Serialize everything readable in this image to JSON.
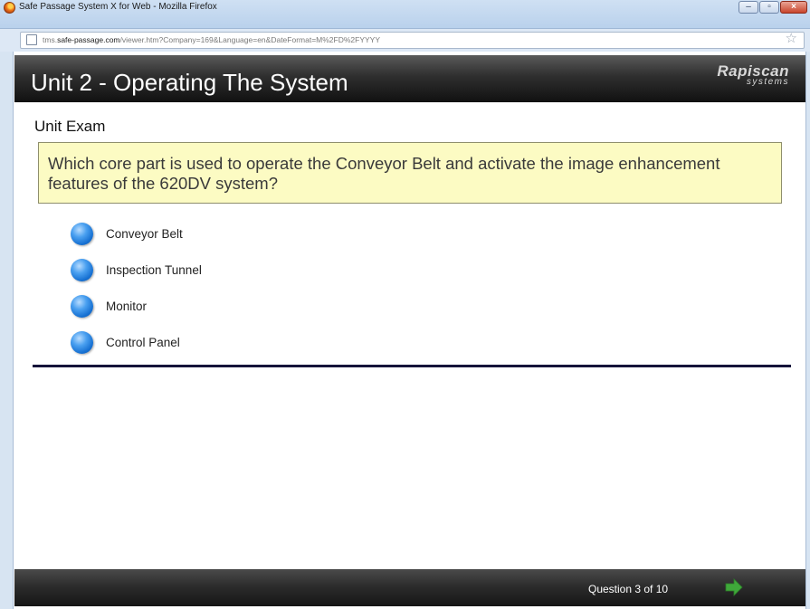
{
  "window": {
    "title": "Safe Passage System X for Web - Mozilla Firefox",
    "controls": {
      "minimize": "–",
      "maximize": "▫",
      "close": "×"
    }
  },
  "address_bar": {
    "url_prefix": "tms.",
    "url_domain": "safe-passage.com",
    "url_rest": "/viewer.htm?Company=169&Language=en&DateFormat=M%2FD%2FYYYY"
  },
  "header": {
    "unit_title": "Unit 2 - Operating The System",
    "logo_main": "Rapiscan",
    "logo_sub": "systems"
  },
  "exam": {
    "title": "Unit Exam",
    "question": "Which core part is used to operate the Conveyor Belt and activate the image enhancement features of the 620DV system?",
    "options": [
      {
        "label": "Conveyor Belt"
      },
      {
        "label": "Inspection Tunnel"
      },
      {
        "label": "Monitor"
      },
      {
        "label": "Control Panel"
      }
    ]
  },
  "footer": {
    "question_counter": "Question 3 of 10"
  },
  "colors": {
    "question_bg": "#fcfbc3",
    "radio": "#1670d2",
    "next_arrow": "#3fa83a",
    "header_bg": "#2e2e2e"
  },
  "icons": {
    "browser": "firefox-icon",
    "page": "page-icon",
    "bookmark": "star-icon",
    "next": "next-arrow-icon"
  }
}
